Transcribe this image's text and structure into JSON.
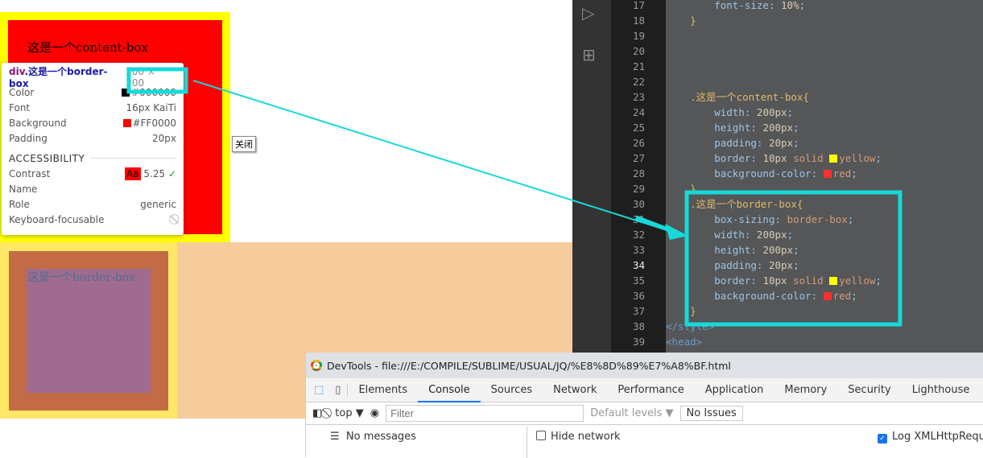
{
  "page": {
    "content_box_text": "这是一个content-box",
    "border_box_text": "这是一个border-box",
    "close_button": "关闭"
  },
  "tooltip": {
    "element": "div.这是一个border-box",
    "size": "200 × 200",
    "rows": [
      {
        "label": "Color",
        "value": "#000000",
        "swatch": "#000000"
      },
      {
        "label": "Font",
        "value": "16px KaiTi"
      },
      {
        "label": "Background",
        "value": "#FF0000",
        "swatch": "#FF0000"
      },
      {
        "label": "Padding",
        "value": "20px"
      }
    ],
    "accessibility_header": "ACCESSIBILITY",
    "contrast": {
      "label": "Contrast",
      "badge": "Aa",
      "value": "5.25"
    },
    "name_label": "Name",
    "role_label": "Role",
    "role_value": "generic",
    "focusable_label": "Keyboard-focusable"
  },
  "editor": {
    "lines": [
      {
        "n": "17",
        "html": "        <span class='p'>font-size</span>: <span class='v'>10%</span>;"
      },
      {
        "n": "18",
        "html": "    <span class='k'>}</span>"
      },
      {
        "n": "19",
        "html": ""
      },
      {
        "n": "20",
        "html": ""
      },
      {
        "n": "21",
        "html": ""
      },
      {
        "n": "22",
        "html": ""
      },
      {
        "n": "23",
        "html": "    <span class='k'>.这是一个content-box{</span>"
      },
      {
        "n": "24",
        "html": "        <span class='p'>width</span>: <span class='v'>200px</span>;"
      },
      {
        "n": "25",
        "html": "        <span class='p'>height</span>: <span class='v'>200px</span>;"
      },
      {
        "n": "26",
        "html": "        <span class='p'>padding</span>: <span class='v'>20px</span>;"
      },
      {
        "n": "27",
        "html": "        <span class='p'>border</span>: <span class='v'>10px</span> <span class='kw'>solid</span> <span class='sw' style='background:#ffff00'></span><span class='kw'>yellow</span>;"
      },
      {
        "n": "28",
        "html": "        <span class='p'>background-color</span>: <span class='sw' style='background:#ff3030'></span><span class='kw'>red</span>;"
      },
      {
        "n": "29",
        "html": "    <span class='k'>}</span>"
      },
      {
        "n": "30",
        "html": "    <span class='k'>.这是一个border-box{</span>"
      },
      {
        "n": "31",
        "html": "        <span class='p'>box-sizing</span>: <span class='kw'>border-box</span>;"
      },
      {
        "n": "32",
        "html": "        <span class='p'>width</span>: <span class='v'>200px</span>;"
      },
      {
        "n": "33",
        "html": "        <span class='p'>height</span>: <span class='v'>200px</span>;"
      },
      {
        "n": "34",
        "html": "        <span class='p'>padding</span>: <span class='v'>20px</span>;"
      },
      {
        "n": "35",
        "html": "        <span class='p'>border</span>: <span class='v'>10px</span> <span class='kw'>solid</span> <span class='sw' style='background:#ffff00'></span><span class='kw'>yellow</span>;"
      },
      {
        "n": "36",
        "html": "        <span class='p'>background-color</span>: <span class='sw' style='background:#ff3030'></span><span class='kw'>red</span>;"
      },
      {
        "n": "37",
        "html": "    <span class='k'>}</span>"
      },
      {
        "n": "38",
        "html": "<span class='t'>&lt;/style&gt;</span>"
      },
      {
        "n": "39",
        "html": "<span class='t'>&lt;head&gt;</span>"
      }
    ]
  },
  "devtools": {
    "title": "DevTools - file:///E:/COMPILE/SUBLIME/USUAL/JQ/%E8%8D%89%E7%A8%BF.html",
    "tabs": [
      "Elements",
      "Console",
      "Sources",
      "Network",
      "Performance",
      "Application",
      "Memory",
      "Security",
      "Lighthouse"
    ],
    "active_tab": "Console",
    "context": "top ▼",
    "filter_placeholder": "Filter",
    "levels": "Default levels ▼",
    "issues": "No Issues",
    "sidebar_item": "No messages",
    "hide_network": "Hide network",
    "log_xhr": "Log XMLHttpRequests",
    "log_xhr_checked": true,
    "hide_network_checked": false
  },
  "colors": {
    "annotation": "#16d9d9",
    "accent": "#1a73e8"
  }
}
